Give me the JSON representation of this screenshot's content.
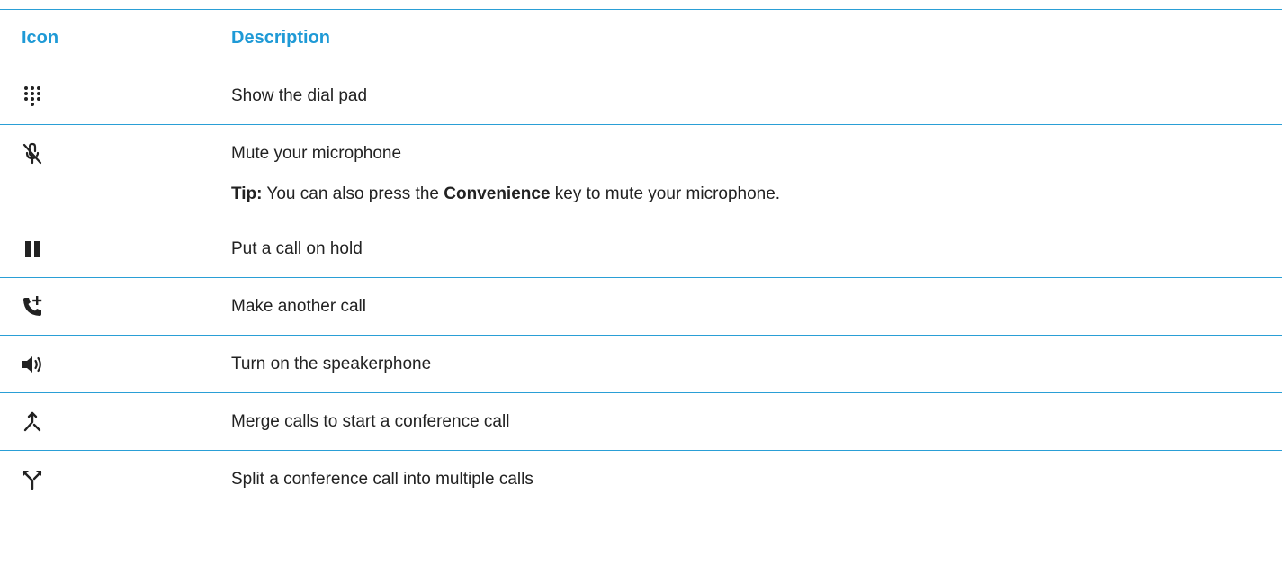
{
  "header": {
    "icon_col": "Icon",
    "desc_col": "Description"
  },
  "rows": [
    {
      "icon": "dial-pad-icon",
      "description": "Show the dial pad"
    },
    {
      "icon": "mute-microphone-icon",
      "description": "Mute your microphone",
      "tip": {
        "prefix": "Tip:",
        "text_before": " You can also press the ",
        "key": "Convenience",
        "text_after": " key to mute your microphone."
      }
    },
    {
      "icon": "pause-icon",
      "description": "Put a call on hold"
    },
    {
      "icon": "add-call-icon",
      "description": "Make another call"
    },
    {
      "icon": "speakerphone-icon",
      "description": "Turn on the speakerphone"
    },
    {
      "icon": "merge-calls-icon",
      "description": "Merge calls to start a conference call"
    },
    {
      "icon": "split-calls-icon",
      "description": "Split a conference call into multiple calls"
    }
  ],
  "colors": {
    "accent": "#1f9ad6",
    "rule": "#2a9fd6",
    "text": "#222222"
  }
}
